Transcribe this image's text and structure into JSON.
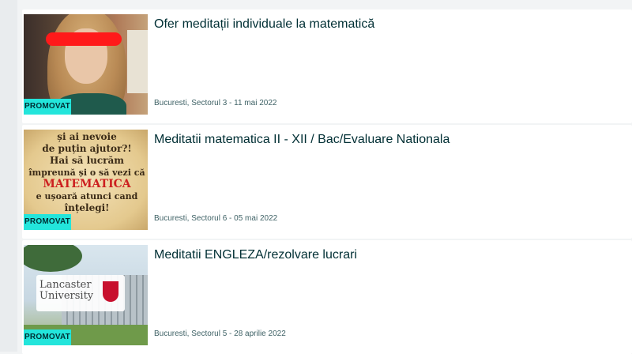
{
  "listings": [
    {
      "title": "Ofer meditații individuale la matematică",
      "meta": "Bucuresti, Sectorul 3 - 11 mai 2022",
      "badge": "PROMOVAT"
    },
    {
      "title": "Meditatii matematica II - XII / Bac/Evaluare Nationala",
      "meta": "Bucuresti, Sectorul 6 - 05 mai 2022",
      "badge": "PROMOVAT",
      "image_text": {
        "line1": "...nevoie...",
        "line2": "și ai nevoie",
        "line3": "de puțin ajutor?!",
        "line4": "Hai să lucrăm",
        "line5": "împreună și o să vezi că",
        "line6": "MATEMATICA",
        "line7": "e ușoară atunci cand",
        "line8": "înțelegi!"
      }
    },
    {
      "title": "Meditatii ENGLEZA/rezolvare lucrari",
      "meta": "Bucuresti, Sectorul 5 - 28 aprilie 2022",
      "badge": "PROMOVAT",
      "image_text": {
        "logo": "Lancaster University"
      }
    }
  ],
  "colors": {
    "badge_bg": "#23e5db",
    "title": "#002f34",
    "meta": "#406367"
  }
}
